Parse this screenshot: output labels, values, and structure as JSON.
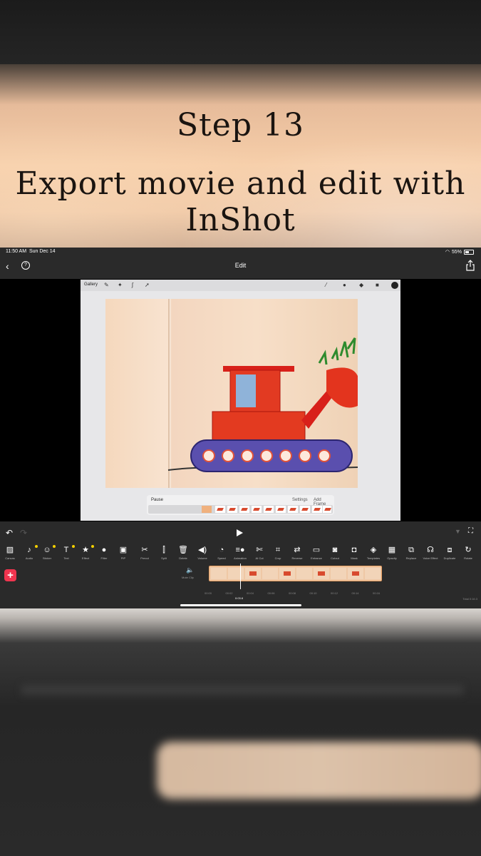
{
  "banner": {
    "line1": "Step 13",
    "line2": "Export movie and edit with InShot"
  },
  "status_bar": {
    "time": "11:50 AM",
    "date": "Sun Dec 14",
    "battery": "55%"
  },
  "nav": {
    "title": "Edit",
    "back_icon": "chevron-left-icon",
    "help_icon": "help-icon",
    "share_icon": "share-icon"
  },
  "procreate": {
    "gallery": "Gallery",
    "panel": {
      "pause": "Pause",
      "settings": "Settings",
      "add_frame": "Add Frame"
    }
  },
  "toolbar": [
    {
      "label": "Canvas",
      "icon": "canvas-icon",
      "glyph": "▨",
      "dot": false
    },
    {
      "label": "Audio",
      "icon": "music-icon",
      "glyph": "♪",
      "dot": true
    },
    {
      "label": "Sticker",
      "icon": "smiley-icon",
      "glyph": "☺",
      "dot": true
    },
    {
      "label": "Text",
      "icon": "text-icon",
      "glyph": "T",
      "dot": true
    },
    {
      "label": "Effect",
      "icon": "star-icon",
      "glyph": "★",
      "dot": true
    },
    {
      "label": "Filter",
      "icon": "filter-icon",
      "glyph": "●",
      "dot": false
    },
    {
      "label": "PIP",
      "icon": "pip-icon",
      "glyph": "▣",
      "dot": false
    },
    {
      "label": "Precut",
      "icon": "scissors-icon",
      "glyph": "✂",
      "dot": false
    },
    {
      "label": "Split",
      "icon": "split-icon",
      "glyph": "⫿",
      "dot": false
    },
    {
      "label": "Delete",
      "icon": "trash-icon",
      "glyph": "🗑",
      "dot": false
    },
    {
      "label": "Volume",
      "icon": "volume-icon",
      "glyph": "◀)",
      "dot": false
    },
    {
      "label": "Speed",
      "icon": "speed-icon",
      "glyph": "◔",
      "dot": false
    },
    {
      "label": "Animation",
      "icon": "animation-icon",
      "glyph": "≡●",
      "dot": false
    },
    {
      "label": "AI Cut",
      "icon": "ai-cut-icon",
      "glyph": "✄",
      "dot": false
    },
    {
      "label": "Crop",
      "icon": "crop-icon",
      "glyph": "⌗",
      "dot": false
    },
    {
      "label": "Reverse",
      "icon": "shuffle-icon",
      "glyph": "⇄",
      "dot": false
    },
    {
      "label": "Enhance",
      "icon": "hdr-icon",
      "glyph": "▭",
      "dot": false
    },
    {
      "label": "Cutout",
      "icon": "cutout-icon",
      "glyph": "◙",
      "dot": false
    },
    {
      "label": "Mask",
      "icon": "mask-icon",
      "glyph": "◘",
      "dot": false
    },
    {
      "label": "Templates",
      "icon": "templates-icon",
      "glyph": "◈",
      "dot": false
    },
    {
      "label": "Opacity",
      "icon": "opacity-icon",
      "glyph": "▦",
      "dot": false
    },
    {
      "label": "Replace",
      "icon": "replace-icon",
      "glyph": "⧉",
      "dot": false
    },
    {
      "label": "Voice Effect",
      "icon": "voice-effect-icon",
      "glyph": "☊",
      "dot": false
    },
    {
      "label": "Duplicate",
      "icon": "duplicate-icon",
      "glyph": "⧈",
      "dot": false
    },
    {
      "label": "Rotate",
      "icon": "rotate-icon",
      "glyph": "↻",
      "dot": false
    }
  ],
  "timeline": {
    "mute_label": "Mute Clip",
    "ticks": [
      "00:00",
      "00:02",
      "00:04",
      "00:06",
      "00:08",
      "00:10",
      "00:12",
      "00:14",
      "00:16"
    ],
    "current_time": "0:03.6",
    "total": "Total 0:16.3"
  }
}
